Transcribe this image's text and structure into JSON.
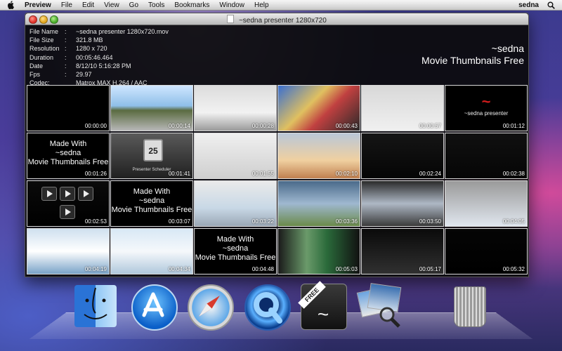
{
  "menubar": {
    "apple_icon": "apple-icon",
    "app_name": "Preview",
    "items": [
      "File",
      "Edit",
      "View",
      "Go",
      "Tools",
      "Bookmarks",
      "Window",
      "Help"
    ],
    "user": "sedna",
    "search_icon": "spotlight-search-icon"
  },
  "window": {
    "title": "~sedna presenter 1280x720",
    "info": [
      {
        "label": "File Name",
        "value": "~sedna presenter 1280x720.mov"
      },
      {
        "label": "File Size",
        "value": "321.8 MB"
      },
      {
        "label": "Resolution",
        "value": "1280 x 720"
      },
      {
        "label": "Duration",
        "value": "00:05:46.464"
      },
      {
        "label": "Date",
        "value": "8/12/10 5:16:28 PM"
      },
      {
        "label": "Fps",
        "value": "29.97"
      },
      {
        "label": "Codec:",
        "value": "Matrox MAX H.264 / AAC"
      }
    ],
    "info_colon": ":",
    "brand_line1": "~sedna",
    "brand_line2": "Movie Thumbnails Free",
    "thumbnails": [
      {
        "time": "00:00:00"
      },
      {
        "time": "00:00:14"
      },
      {
        "time": "00:00:28"
      },
      {
        "time": "00:00:43"
      },
      {
        "time": "00:00:57"
      },
      {
        "time": "00:01:12"
      },
      {
        "time": "00:01:26"
      },
      {
        "time": "00:01:41"
      },
      {
        "time": "00:01:55"
      },
      {
        "time": "00:02:10"
      },
      {
        "time": "00:02:24"
      },
      {
        "time": "00:02:38"
      },
      {
        "time": "00:02:53"
      },
      {
        "time": "00:03:07"
      },
      {
        "time": "00:03:22"
      },
      {
        "time": "00:03:36"
      },
      {
        "time": "00:03:50"
      },
      {
        "time": "00:04:05"
      },
      {
        "time": "00:04:19"
      },
      {
        "time": "00:04:34"
      },
      {
        "time": "00:04:48"
      },
      {
        "time": "00:05:03"
      },
      {
        "time": "00:05:17"
      },
      {
        "time": "00:05:32"
      }
    ],
    "thumb_made_with": [
      "Made With",
      "~sedna",
      "Movie Thumbnails Free"
    ],
    "thumb_presenter": "~sedna presenter",
    "thumb_scheduler": "Presenter Scheduler",
    "thumb_calendar_num": "25"
  },
  "dock": {
    "items": [
      {
        "name": "Finder",
        "icon": "finder-icon"
      },
      {
        "name": "App Store",
        "icon": "app-store-icon"
      },
      {
        "name": "Safari",
        "icon": "safari-icon"
      },
      {
        "name": "QuickTime Player",
        "icon": "quicktime-icon"
      },
      {
        "name": "sedna Movie Thumbnails Free",
        "icon": "sedna-thumbnails-app-icon",
        "ribbon": "FREE"
      },
      {
        "name": "Preview",
        "icon": "preview-icon"
      },
      {
        "name": "Trash",
        "icon": "trash-icon"
      }
    ],
    "sedna_ribbon": "FREE"
  },
  "colors": {
    "accent_red": "#d21c1c",
    "window_bg": "#0a0a0a",
    "thumb_border": "#d8d8d8"
  }
}
